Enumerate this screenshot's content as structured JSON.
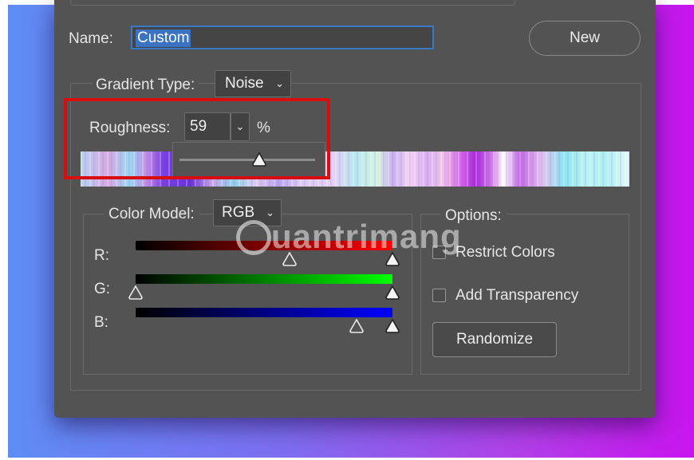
{
  "dialog": {
    "name_label": "Name:",
    "name_value": "Custom",
    "new_button": "New"
  },
  "gradient_type": {
    "label": "Gradient Type:",
    "value": "Noise"
  },
  "roughness": {
    "label": "Roughness:",
    "value": "59",
    "unit": "%",
    "slider_level_percent": 59
  },
  "color_model": {
    "label": "Color Model:",
    "value": "RGB",
    "channels": [
      {
        "label": "R:",
        "color": "#ff0000",
        "min_stop": 0.6,
        "max_stop": 1.0
      },
      {
        "label": "G:",
        "color": "#00ff00",
        "min_stop": 0.0,
        "max_stop": 1.0
      },
      {
        "label": "B:",
        "color": "#0000ff",
        "min_stop": 0.86,
        "max_stop": 1.0
      }
    ]
  },
  "options": {
    "label": "Options:",
    "restrict_colors": "Restrict Colors",
    "add_transparency": "Add Transparency",
    "randomize_button": "Randomize"
  },
  "watermark": {
    "text": "uantrimang"
  },
  "colors": {
    "dialog_bg": "#535353",
    "highlight_red": "#d80d0d",
    "selection_blue": "#3b73c2"
  }
}
